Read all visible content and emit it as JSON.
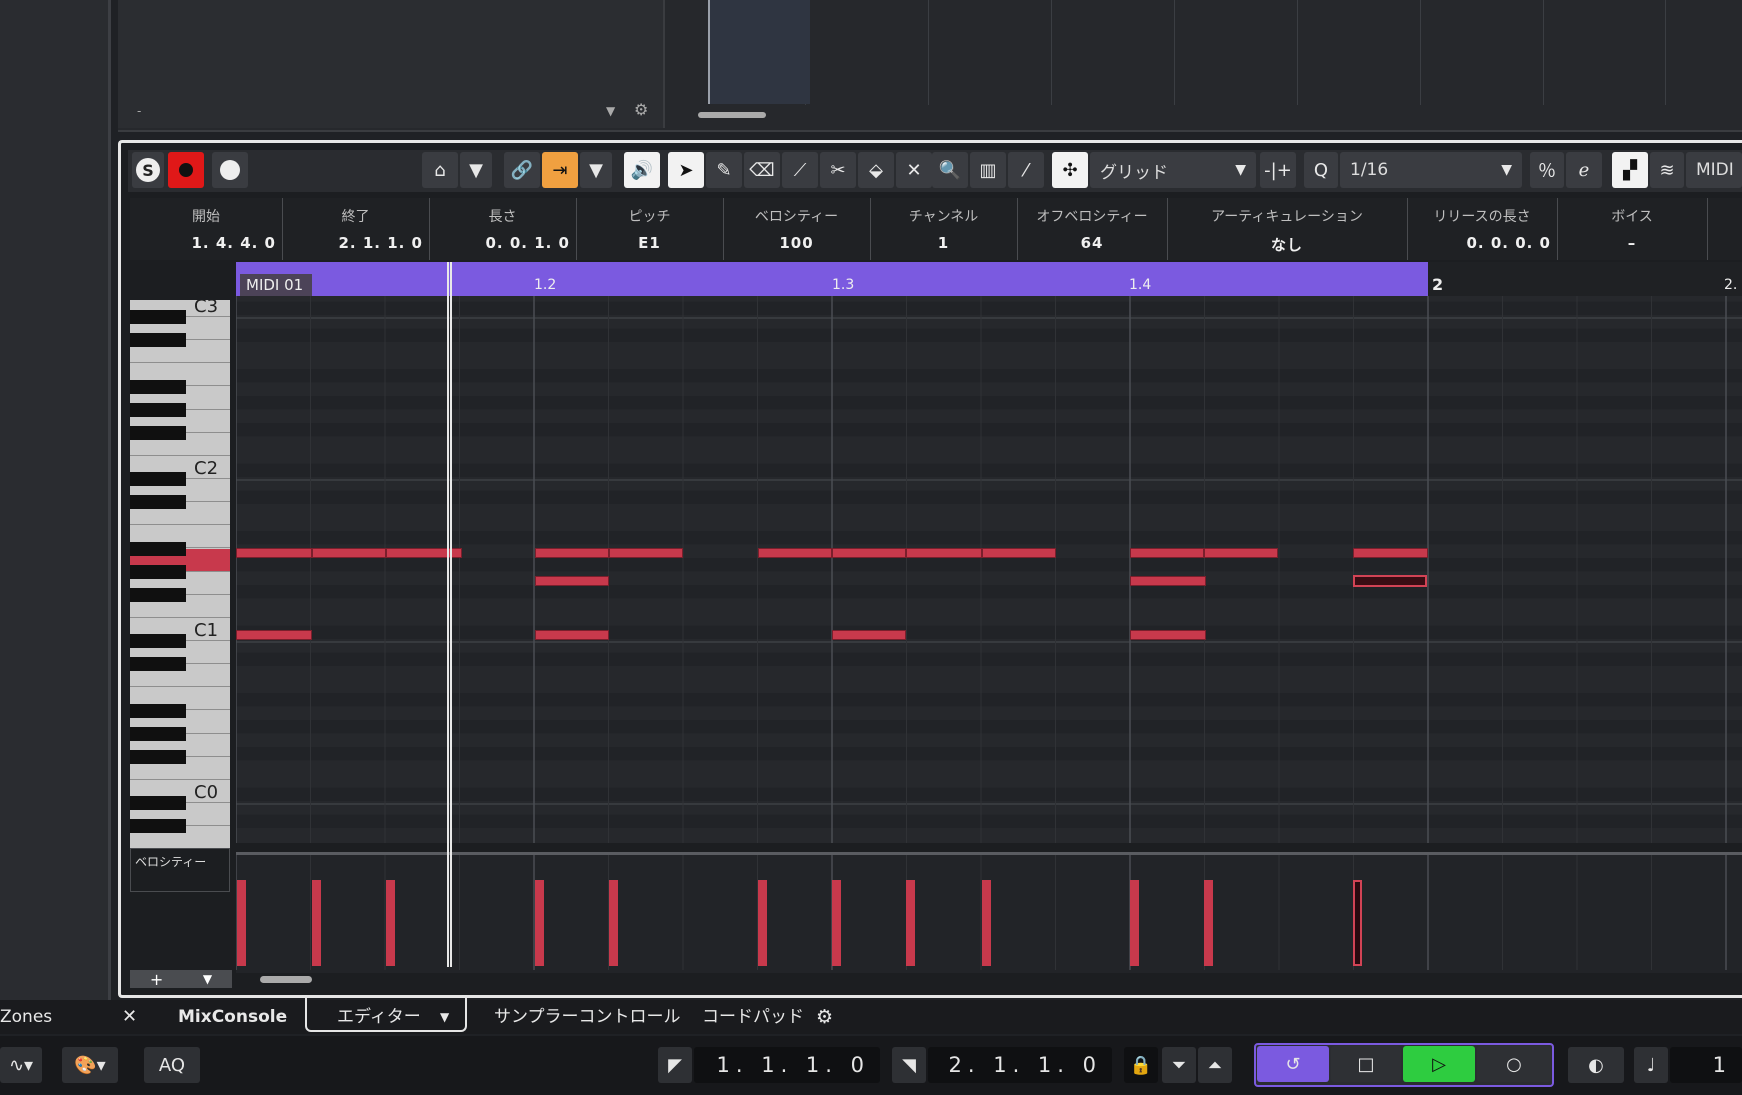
{
  "top_area": {
    "dash": "-"
  },
  "toolbar": {
    "snap_mode": "グリッド",
    "quantize_value": "1/16",
    "midi_label": "MIDI"
  },
  "info_line": [
    {
      "label": "開始",
      "value": "1. 4. 4.   0"
    },
    {
      "label": "終了",
      "value": "2. 1. 1.   0"
    },
    {
      "label": "長さ",
      "value": "0. 0. 1.   0"
    },
    {
      "label": "ピッチ",
      "value": "E1"
    },
    {
      "label": "ベロシティー",
      "value": "100"
    },
    {
      "label": "チャンネル",
      "value": "1"
    },
    {
      "label": "オフベロシティー",
      "value": "64"
    },
    {
      "label": "アーティキュレーション",
      "value": "なし"
    },
    {
      "label": "リリースの長さ",
      "value": "0. 0. 0.   0"
    },
    {
      "label": "ボイス",
      "value": "–"
    }
  ],
  "ruler": {
    "part_name": "MIDI 01",
    "markers": [
      "1.2",
      "1.3",
      "1.4",
      "2",
      "2."
    ]
  },
  "keyboard": {
    "labels": [
      "C3",
      "C2",
      "C1",
      "C0"
    ]
  },
  "velocity_lane": {
    "label": "ベロシティー"
  },
  "tabs": {
    "zones": "Zones",
    "mixconsole": "MixConsole",
    "editor": "エディター",
    "sampler": "サンプラーコントロール",
    "chordpad": "コードパッド"
  },
  "transport": {
    "aq": "AQ",
    "left_locator": "1. 1. 1.   0",
    "right_locator": "2. 1. 1.   0",
    "tempo_partial": "1"
  },
  "colors": {
    "accent": "#7b5ae0",
    "note": "#c8394c",
    "record": "#e01818",
    "play": "#2ecc40",
    "snap_active": "#f0a040"
  }
}
